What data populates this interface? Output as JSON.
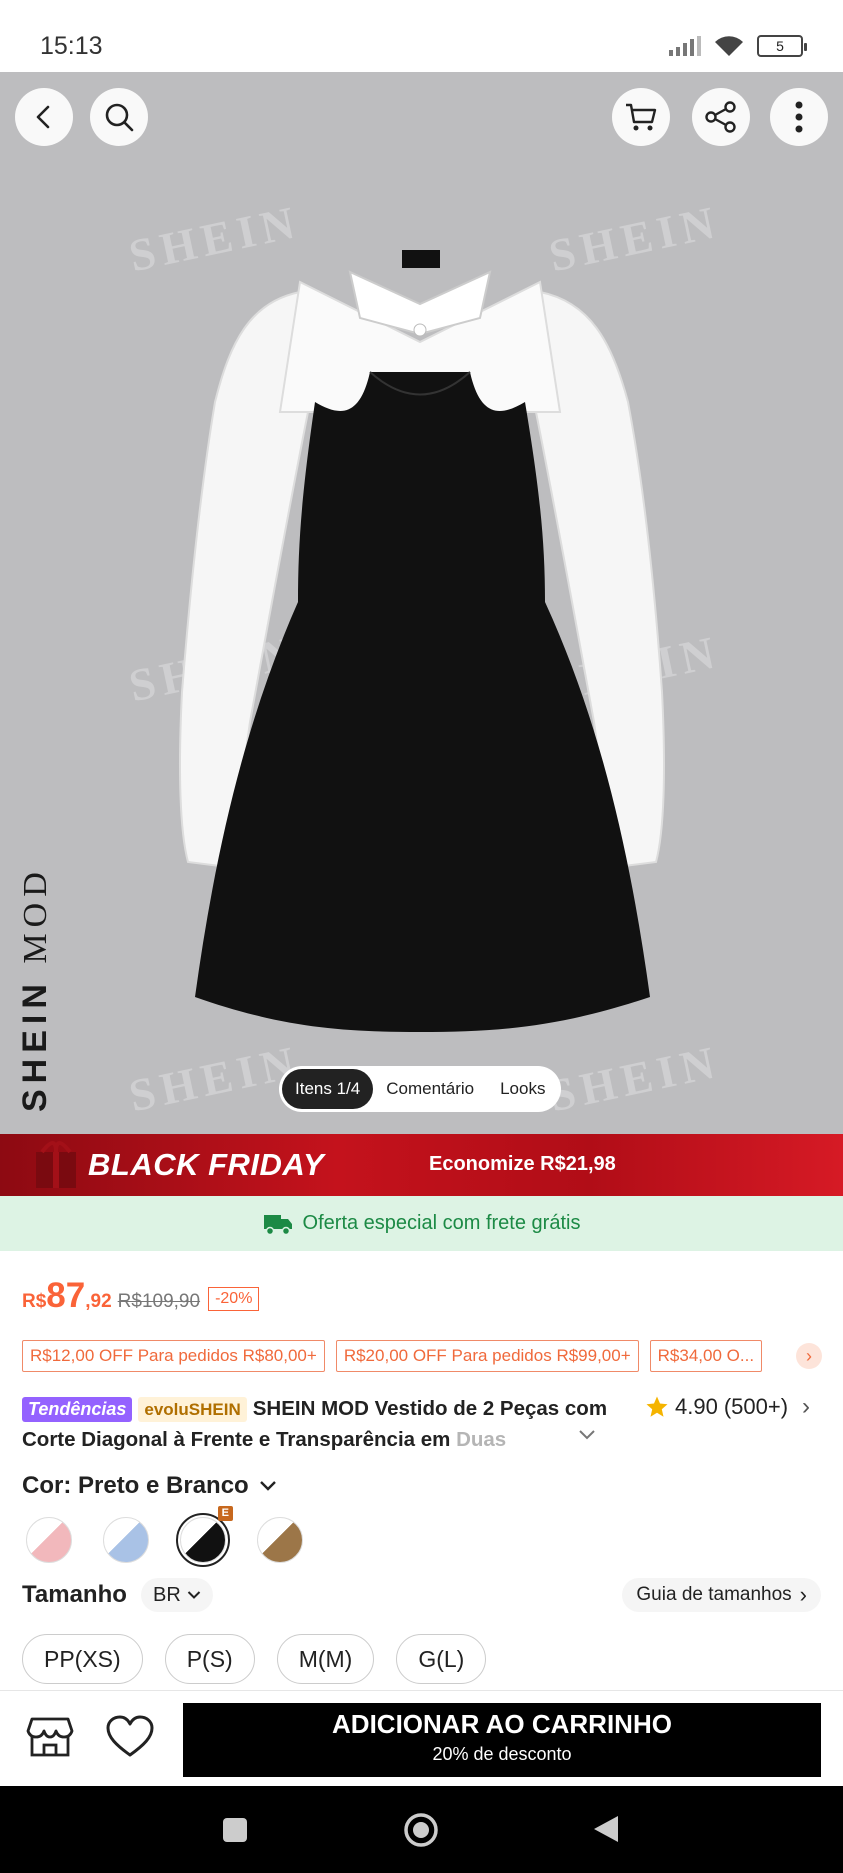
{
  "status_bar": {
    "time": "15:13",
    "battery": "5"
  },
  "hero": {
    "watermark": "SHEIN",
    "brand_vertical_a": "SHEIN",
    "brand_vertical_b": "MOD",
    "image_tabs": [
      "Itens 1/4",
      "Comentário",
      "Looks"
    ],
    "icons": [
      "back-icon",
      "search-icon",
      "cart-icon",
      "share-icon",
      "more-icon"
    ]
  },
  "black_friday": {
    "title": "BLACK FRIDAY",
    "savings": "Economize R$21,98"
  },
  "shipping": {
    "text": "Oferta especial com frete grátis"
  },
  "price": {
    "currency": "R$",
    "integer": "87",
    "decimal": ",92",
    "original": "R$109,90",
    "discount": "-20%"
  },
  "coupons": [
    "R$12,00 OFF Para pedidos R$80,00+",
    "R$20,00 OFF Para pedidos R$99,00+",
    "R$34,00 O..."
  ],
  "product": {
    "tag_trend": "Tendências",
    "tag_evolu": "evoluSHEIN",
    "title_main": "SHEIN MOD Vestido de 2 Peças com Corte Diagonal à Frente e Transparência em",
    "title_fade": "Duas",
    "rating": "4.90",
    "rating_count": "(500+)"
  },
  "color": {
    "label": "Cor: Preto e Branco",
    "badge": "E",
    "swatches": [
      "rosa-branco",
      "azul-branco",
      "preto-branco",
      "marrom-branco"
    ]
  },
  "size": {
    "label": "Tamanho",
    "region": "BR",
    "guide": "Guia de tamanhos",
    "options": [
      "PP(XS)",
      "P(S)",
      "M(M)",
      "G(L)"
    ]
  },
  "bottom": {
    "cart_main": "ADICIONAR AO CARRINHO",
    "cart_sub": "20% de desconto"
  },
  "colors": {
    "accent": "#fa6338",
    "bf_red": "#c4121c",
    "ship_green": "#1c8a45",
    "trend_purple": "#9462ff"
  }
}
